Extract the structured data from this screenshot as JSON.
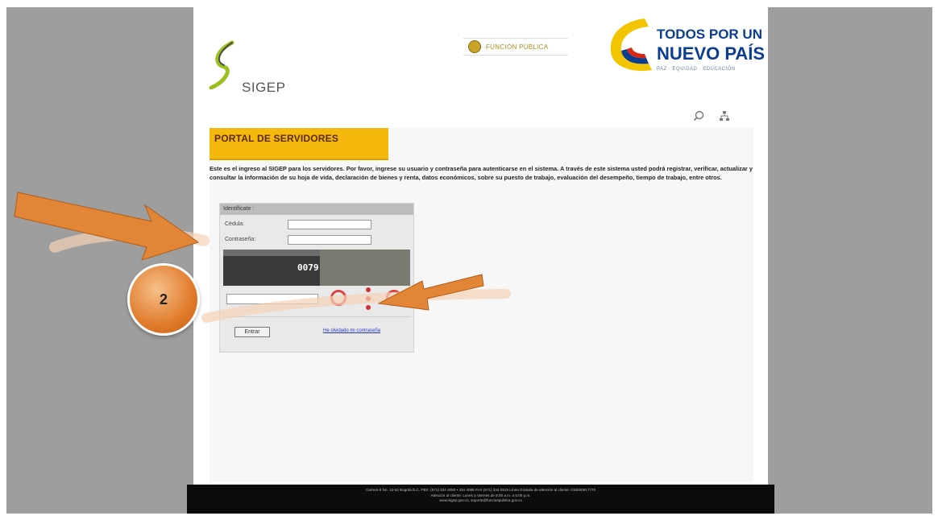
{
  "header": {
    "sigep_logo_text": "SIGEP",
    "funcion_publica_text": "FUNCIÓN PÚBLICA",
    "slogan_line1": "TODOS POR UN",
    "slogan_line2": "NUEVO PAÍS",
    "slogan_line3": "PAZ · EQUIDAD · EDUCACIÓN",
    "icons": [
      "search-icon",
      "sitemap-icon"
    ]
  },
  "portal": {
    "tab_title": "PORTAL DE SERVIDORES",
    "intro": "Este es el ingreso al SIGEP para los servidores. Por favor, ingrese su usuario y contraseña para autenticarse en el sistema. A través de este sistema usted podrá registrar, verificar, actualizar y consultar la información de su hoja de vida, declaración de bienes y renta, datos económicos, sobre su puesto de trabajo, evaluación del desempeño, tiempo de trabajo, entre otros."
  },
  "login": {
    "header": "Identifícate :",
    "cedula_label": "Cédula:",
    "cedula_value": "",
    "password_label": "Contraseña:",
    "password_value": "",
    "captcha_code": "0079",
    "captcha_input_value": "",
    "submit_label": "Entrar",
    "forgot_link": "He olvidado mi contraseña"
  },
  "footer": {
    "line1": "Carrera 6 No. 12-62 Bogotá D.C. PBX: (571) 334 4080 • 334 4088 FAX (571) 334 0515 Línea Gratuita de atención al cliente: 018000917770",
    "line2": "Atención al cliente: Lunes a Viernes de 8:00 a.m. a 5:00 p.m.",
    "line3": "www.sigep.gov.co, soporte@funcionpublica.gov.co"
  },
  "annotation": {
    "step_number": "2"
  }
}
